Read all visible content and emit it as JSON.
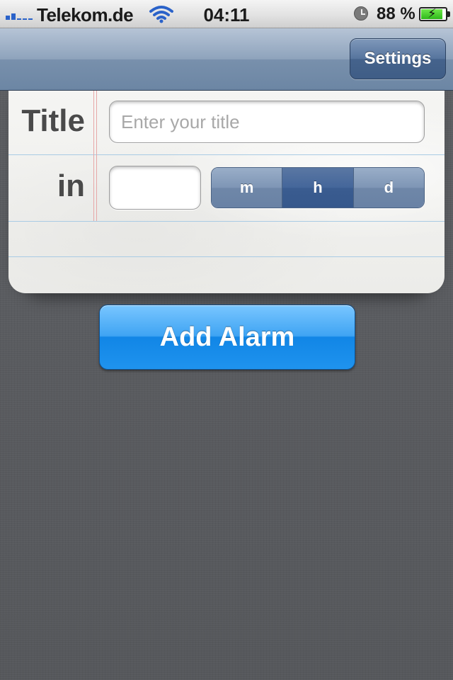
{
  "status_bar": {
    "carrier": "Telekom.de",
    "time": "04:11",
    "battery_percent_text": "88 %",
    "battery_level": 0.88,
    "signal_icon": "signal-bars-icon",
    "wifi_icon": "wifi-icon",
    "alarm_icon": "alarm-clock-icon",
    "battery_icon": "battery-charging-icon"
  },
  "nav_bar": {
    "settings_label": "Settings"
  },
  "form": {
    "title_label": "Title",
    "title_placeholder": "Enter your title",
    "title_value": "",
    "in_label": "in",
    "amount_value": "",
    "units": [
      {
        "label": "m",
        "selected": false
      },
      {
        "label": "h",
        "selected": true
      },
      {
        "label": "d",
        "selected": false
      }
    ]
  },
  "actions": {
    "add_alarm_label": "Add Alarm"
  },
  "colors": {
    "nav_bar": "#7f95b1",
    "accent_button": "#1f93ee",
    "segment_selected": "#3a5c90",
    "background": "#5b5d61"
  }
}
